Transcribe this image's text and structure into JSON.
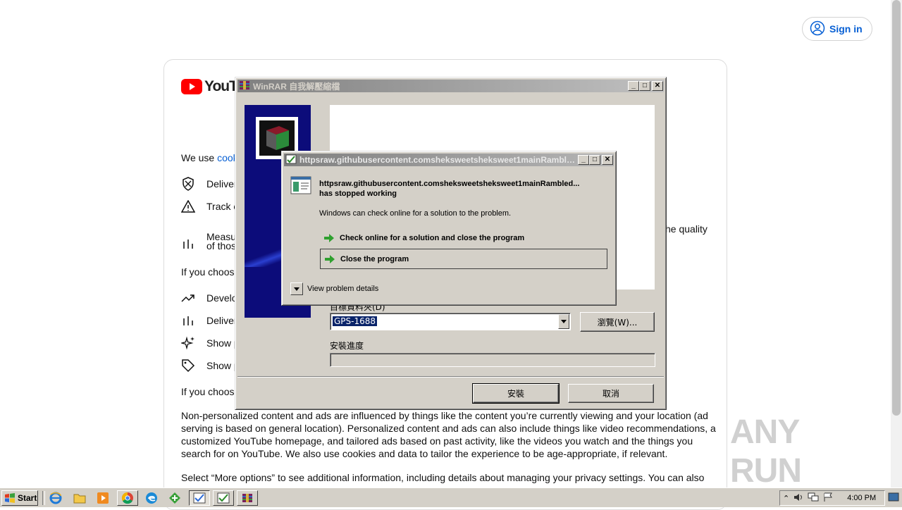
{
  "browser": {
    "signin_label": "Sign in",
    "logo_text": "YouTu",
    "we_use_prefix": "We use ",
    "we_use_link": "cook",
    "list1": [
      {
        "icon": "shield-icon",
        "text": "Deliver"
      },
      {
        "icon": "warning-icon",
        "text": "Track o"
      },
      {
        "icon": "bar-chart-icon",
        "text": "Measu"
      }
    ],
    "measure_line2": "of thos",
    "quality_fragment": "he quality",
    "if_choose_1": "If you choos",
    "list2": [
      {
        "icon": "trending-icon",
        "text": "Develo"
      },
      {
        "icon": "bar-chart-icon",
        "text": "Deliver"
      },
      {
        "icon": "sparkle-icon",
        "text": "Show p"
      },
      {
        "icon": "tag-icon",
        "text": "Show p"
      }
    ],
    "if_choose_2": "If you choos",
    "paragraph1": "Non-personalized content and ads are influenced by things like the content you’re currently viewing and your location (ad serving is based on general location). Personalized content and ads can also include things like video recommendations, a customized YouTube homepage, and tailored ads based on past activity, like the videos you watch and the things you search for on YouTube. We also use cookies and data to tailor the experience to be age-appropriate, if relevant.",
    "paragraph2": "Select “More options” to see additional information, including details about managing your privacy settings. You can also",
    "watermark": "ANY RUN"
  },
  "winrar": {
    "title": "WinRAR 自我解壓縮檔",
    "folder_label": "目標資料夾(D)",
    "folder_value": "GPS-1688",
    "browse_label": "瀏覽(W)...",
    "progress_label": "安裝進度",
    "progress": 0,
    "install_label": "安裝",
    "cancel_label": "取消"
  },
  "error_dialog": {
    "title": "httpsraw.githubusercontent.comsheksweetsheksweet1mainRamble...",
    "app_name": "httpsraw.githubusercontent.comsheksweetsheksweet1mainRambled...",
    "stopped": "has stopped working",
    "info": "Windows can check online for a solution to the problem.",
    "option1": "Check online for a solution and close the program",
    "option2": "Close the program",
    "details": "View problem details"
  },
  "taskbar": {
    "start_label": "Start",
    "clock": "4:00 PM"
  }
}
